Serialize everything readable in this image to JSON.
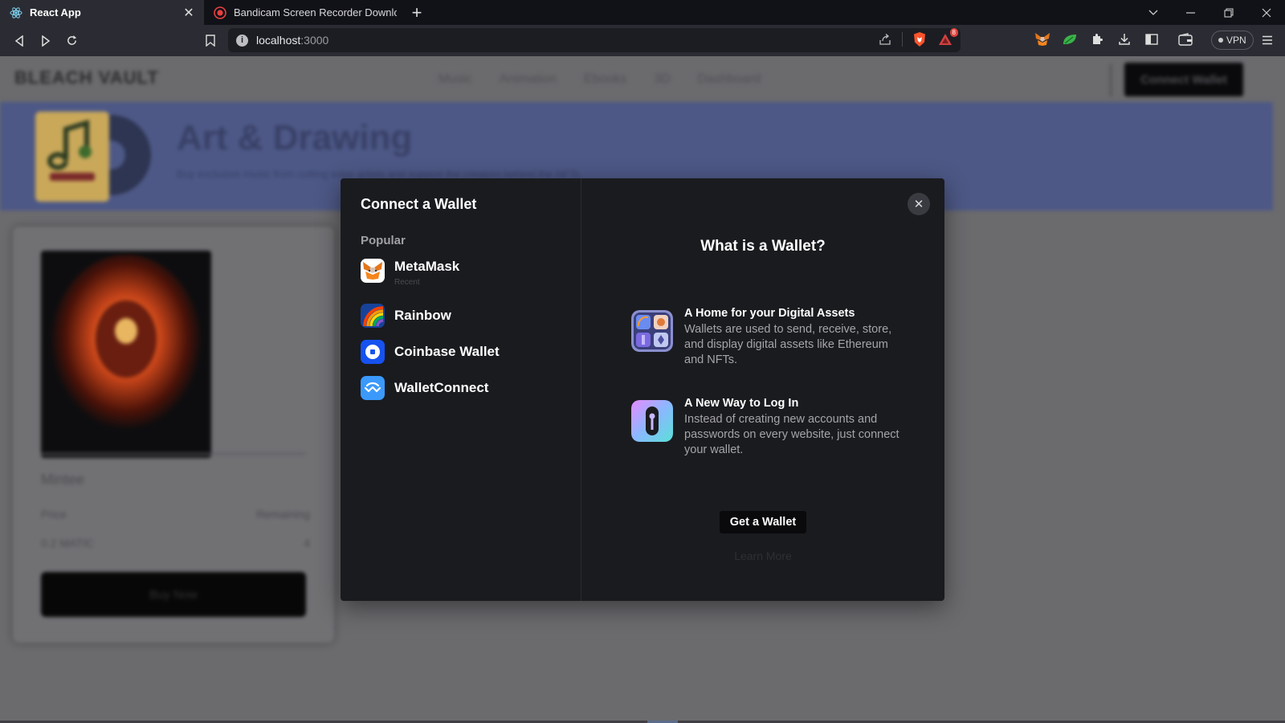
{
  "browser": {
    "tabs": [
      {
        "title": "React App",
        "active": true,
        "favicon": "react-icon"
      },
      {
        "title": "Bandicam Screen Recorder Download",
        "active": false,
        "favicon": "bandicam-icon"
      }
    ],
    "url_host": "localhost",
    "url_port": ":3000",
    "notification_count": "8",
    "vpn_label": "VPN"
  },
  "site": {
    "logo": "BLEACH VAULT",
    "nav": [
      "Music",
      "Animation",
      "Ebooks",
      "3D",
      "Dashboard"
    ],
    "connect_label": "Connect Wallet",
    "banner_title": "Art & Drawing",
    "banner_subtitle": "Buy exclusive music from cutting edge artists and support the creators behind the NFTs",
    "product": {
      "name": "Mintee",
      "price_label": "Price",
      "remaining_label": "Remaining",
      "price_value": "0.2 MATIC",
      "remaining_value": "4",
      "buy_label": "Buy Now"
    }
  },
  "modal": {
    "title": "Connect a Wallet",
    "group_label": "Popular",
    "wallets": [
      {
        "label": "MetaMask",
        "sub": "Recent",
        "icon": "metamask-icon"
      },
      {
        "label": "Rainbow",
        "icon": "rainbow-icon"
      },
      {
        "label": "Coinbase Wallet",
        "icon": "coinbase-icon"
      },
      {
        "label": "WalletConnect",
        "icon": "walletconnect-icon"
      }
    ],
    "right_title": "What is a Wallet?",
    "info": [
      {
        "heading": "A Home for your Digital Assets",
        "text": "Wallets are used to send, receive, store, and display digital assets like Ethereum and NFTs."
      },
      {
        "heading": "A New Way to Log In",
        "text": "Instead of creating new accounts and passwords on every website, just connect your wallet."
      }
    ],
    "get_wallet_label": "Get a Wallet",
    "learn_more_label": "Learn More",
    "close_label": "✕"
  },
  "colors": {
    "modal_bg": "#1a1b1f",
    "banner": "#4d5886",
    "coinbase_blue": "#1652f0",
    "walletconnect_blue": "#3b99fc"
  }
}
